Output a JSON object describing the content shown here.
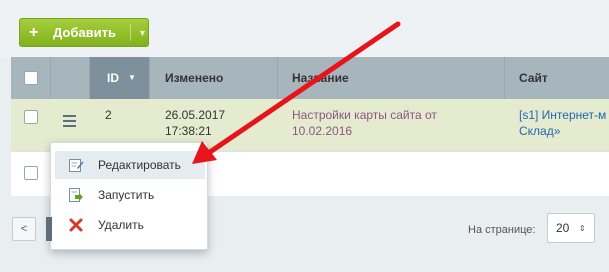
{
  "toolbar": {
    "add_label": "Добавить",
    "plus_glyph": "+",
    "caret_glyph": "▼"
  },
  "grid": {
    "columns": [
      {
        "key": "id",
        "label": "ID",
        "sorted": true,
        "sort_glyph": "▼"
      },
      {
        "key": "modified",
        "label": "Изменено"
      },
      {
        "key": "name",
        "label": "Название"
      },
      {
        "key": "site",
        "label": "Сайт"
      }
    ],
    "rows": [
      {
        "id": "2",
        "modified_date": "26.05.2017",
        "modified_time": "17:38:21",
        "name_line1": "Настройки карты сайта от",
        "name_line2": "10.02.2016",
        "site_line1": "[s1] Интернет-м",
        "site_line2": "Склад»"
      }
    ]
  },
  "context_menu": {
    "items": [
      {
        "label": "Редактировать",
        "icon": "edit-icon",
        "active": true
      },
      {
        "label": "Запустить",
        "icon": "run-icon"
      },
      {
        "label": "Удалить",
        "icon": "delete-icon"
      }
    ]
  },
  "footer": {
    "prev_glyph": "<",
    "per_page_label": "На странице:",
    "per_page_value": "20",
    "per_page_caret": "⇕"
  },
  "colors": {
    "header_bg": "#a7b5bd",
    "sorted_header_bg": "#7d909b",
    "selected_row_bg": "#e5ebcf",
    "add_button": "#8fbf24",
    "annotation_arrow": "#e8141b",
    "link": "#2067b0",
    "name_text": "#8b5583"
  }
}
